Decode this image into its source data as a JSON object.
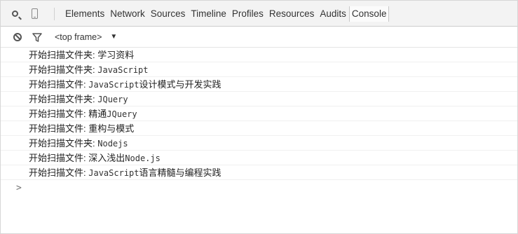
{
  "toolbar": {
    "search_icon": "search-icon",
    "device_icon": "device-mode-icon",
    "tabs": [
      {
        "label": "Elements"
      },
      {
        "label": "Network"
      },
      {
        "label": "Sources"
      },
      {
        "label": "Timeline"
      },
      {
        "label": "Profiles"
      },
      {
        "label": "Resources"
      },
      {
        "label": "Audits"
      },
      {
        "label": "Console",
        "active": true
      }
    ]
  },
  "console": {
    "clear_icon": "clear-console-icon",
    "filter_icon": "filter-icon",
    "frame_select": "<top frame>",
    "frame_arrow": "▼",
    "messages": [
      {
        "prefix": "开始扫描文件夹:",
        "value": "学习资料",
        "mono": false
      },
      {
        "prefix": "开始扫描文件夹:",
        "value": "JavaScript",
        "mono": true
      },
      {
        "prefix": "开始扫描文件:",
        "value": "JavaScript",
        "mono": true,
        "suffix": "设计模式与开发实践"
      },
      {
        "prefix": "开始扫描文件夹:",
        "value": "JQuery",
        "mono": true
      },
      {
        "prefix": "开始扫描文件:",
        "value": "精通",
        "mono": false,
        "suffix_mono": "JQuery"
      },
      {
        "prefix": "开始扫描文件:",
        "value": "重构与模式",
        "mono": false
      },
      {
        "prefix": "开始扫描文件夹:",
        "value": "Nodejs",
        "mono": true
      },
      {
        "prefix": "开始扫描文件:",
        "value": "深入浅出",
        "mono": false,
        "suffix_mono": "Node.js"
      },
      {
        "prefix": "开始扫描文件:",
        "value": "JavaScript",
        "mono": true,
        "suffix": "语言精髓与编程实践"
      }
    ],
    "prompt": ">"
  },
  "colors": {
    "toolbar_bg": "#f3f3f3",
    "text": "#333333",
    "border": "#cdcdcd"
  }
}
